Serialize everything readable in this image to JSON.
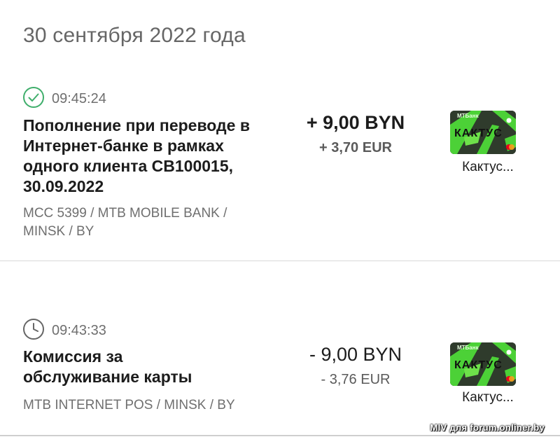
{
  "date_header": "30 сентября 2022 года",
  "transactions": [
    {
      "status": "completed",
      "status_icon": "check-circle-icon",
      "time": "09:45:24",
      "description": "Пополнение при переводе в Интернет-банке в рамках одного клиента CB100015, 30.09.2022",
      "merchant": "MCC 5399 / MTB MOBILE BANK / MINSK / BY",
      "amount": "+ 9,00 BYN",
      "amount_converted": "+ 3,70 EUR",
      "card_name": "Кактус...",
      "card_text": "КАКТУС",
      "card_bank": "МТБанк"
    },
    {
      "status": "pending",
      "status_icon": "clock-icon",
      "time": "09:43:33",
      "description": "Комиссия за обслуживание карты",
      "merchant": "MTB INTERNET POS / MINSK / BY",
      "amount": "- 9,00 BYN",
      "amount_converted": "- 3,76 EUR",
      "card_name": "Кактус...",
      "card_text": "КАКТУС",
      "card_bank": "МТБанк"
    }
  ],
  "watermark": "MIV для forum.onliner.by",
  "colors": {
    "success_green": "#3fae6b",
    "icon_gray": "#666666",
    "card_green": "#4cd137",
    "card_dark": "#2d2d2d"
  }
}
